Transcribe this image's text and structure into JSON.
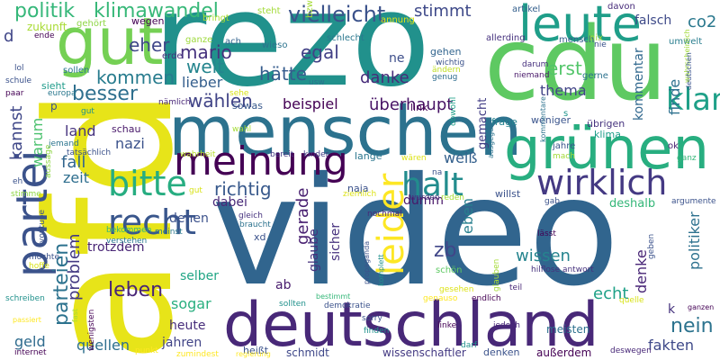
{
  "words": [
    {
      "text": "video",
      "color": "#31658e",
      "vertical": false
    },
    {
      "text": "afd",
      "color": "#e7e419",
      "vertical": true
    },
    {
      "text": "rezo",
      "color": "#21918c",
      "vertical": false
    },
    {
      "text": "cdu",
      "color": "#5ec962",
      "vertical": false
    },
    {
      "text": "menschen",
      "color": "#2c728e",
      "vertical": false
    },
    {
      "text": "deutschland",
      "color": "#482878",
      "vertical": false
    },
    {
      "text": "grünen",
      "color": "#28ae80",
      "vertical": false
    },
    {
      "text": "gut",
      "color": "#75d054",
      "vertical": false
    },
    {
      "text": "meinung",
      "color": "#440154",
      "vertical": false
    },
    {
      "text": "leute",
      "color": "#1f9e89",
      "vertical": false
    },
    {
      "text": "partei",
      "color": "#3b528b",
      "vertical": true
    },
    {
      "text": "wirklich",
      "color": "#443983",
      "vertical": false
    },
    {
      "text": "bitte",
      "color": "#27ad81",
      "vertical": false
    },
    {
      "text": "recht",
      "color": "#39568c",
      "vertical": false
    },
    {
      "text": "leider",
      "color": "#fde725",
      "vertical": true
    },
    {
      "text": "klar",
      "color": "#1fa088",
      "vertical": false
    },
    {
      "text": "vielleicht",
      "color": "#3b528b",
      "vertical": false
    },
    {
      "text": "halt",
      "color": "#228c8d",
      "vertical": false
    },
    {
      "text": "politik",
      "color": "#35b779",
      "vertical": false
    },
    {
      "text": "klimawandel",
      "color": "#37b878",
      "vertical": false
    },
    {
      "text": "stimmt",
      "color": "#3e4989",
      "vertical": false
    },
    {
      "text": "falsch",
      "color": "#3e4a89",
      "vertical": false
    },
    {
      "text": "co2",
      "color": "#2a788e",
      "vertical": false
    },
    {
      "text": "eher",
      "color": "#3f4788",
      "vertical": false
    },
    {
      "text": "mario",
      "color": "#46327e",
      "vertical": false
    },
    {
      "text": "egal",
      "color": "#424086",
      "vertical": false
    },
    {
      "text": "welt",
      "color": "#25858e",
      "vertical": false
    },
    {
      "text": "kommen",
      "color": "#287c8e",
      "vertical": false
    },
    {
      "text": "hätte",
      "color": "#365c8d",
      "vertical": false
    },
    {
      "text": "besser",
      "color": "#2e6f8e",
      "vertical": false
    },
    {
      "text": "lieber",
      "color": "#355f8d",
      "vertical": false
    },
    {
      "text": "danke",
      "color": "#472c7a",
      "vertical": false
    },
    {
      "text": "erst",
      "color": "#52c569",
      "vertical": false
    },
    {
      "text": "thema",
      "color": "#414487",
      "vertical": false
    },
    {
      "text": "finde",
      "color": "#2d708e",
      "vertical": true
    },
    {
      "text": "kommentar",
      "color": "#31688e",
      "vertical": true
    },
    {
      "text": "wählen",
      "color": "#414487",
      "vertical": false
    },
    {
      "text": "beispiel",
      "color": "#440154",
      "vertical": false
    },
    {
      "text": "überhaupt",
      "color": "#471365",
      "vertical": false
    },
    {
      "text": "kannst",
      "color": "#3f4788",
      "vertical": true
    },
    {
      "text": "warum",
      "color": "#4ac16d",
      "vertical": true
    },
    {
      "text": "nazi",
      "color": "#3b528b",
      "vertical": false
    },
    {
      "text": "land",
      "color": "#46337e",
      "vertical": false
    },
    {
      "text": "fall",
      "color": "#32658e",
      "vertical": false
    },
    {
      "text": "zeit",
      "color": "#2e6e8e",
      "vertical": false
    },
    {
      "text": "weiß",
      "color": "#34608d",
      "vertical": false
    },
    {
      "text": "richtig",
      "color": "#38598c",
      "vertical": false
    },
    {
      "text": "eben",
      "color": "#277f8e",
      "vertical": true
    },
    {
      "text": "parteien",
      "color": "#2c728e",
      "vertical": true
    },
    {
      "text": "problem",
      "color": "#443a83",
      "vertical": true
    },
    {
      "text": "trotzdem",
      "color": "#482475",
      "vertical": false
    },
    {
      "text": "leben",
      "color": "#482576",
      "vertical": false
    },
    {
      "text": "sogar",
      "color": "#29af7f",
      "vertical": false
    },
    {
      "text": "heute",
      "color": "#472d7b",
      "vertical": false
    },
    {
      "text": "jahren",
      "color": "#414487",
      "vertical": false
    },
    {
      "text": "geld",
      "color": "#2f6b8e",
      "vertical": false
    },
    {
      "text": "quellen",
      "color": "#2e6f8e",
      "vertical": false
    },
    {
      "text": "gerade",
      "color": "#481f70",
      "vertical": true
    },
    {
      "text": "sicher",
      "color": "#46307e",
      "vertical": true
    },
    {
      "text": "zb",
      "color": "#404688",
      "vertical": false
    },
    {
      "text": "wissen",
      "color": "#25848e",
      "vertical": false
    },
    {
      "text": "denke",
      "color": "#482576",
      "vertical": true
    },
    {
      "text": "echt",
      "color": "#1fa188",
      "vertical": false
    },
    {
      "text": "politiker",
      "color": "#2d718e",
      "vertical": true
    },
    {
      "text": "nein",
      "color": "#2c738e",
      "vertical": false
    },
    {
      "text": "fakten",
      "color": "#3e4989",
      "vertical": false
    },
    {
      "text": "denen",
      "color": "#3b518b",
      "vertical": false
    },
    {
      "text": "selber",
      "color": "#21a685",
      "vertical": false
    },
    {
      "text": "dabei",
      "color": "#482979",
      "vertical": false
    },
    {
      "text": "glaube",
      "color": "#46337e",
      "vertical": true
    },
    {
      "text": "schmidt",
      "color": "#3f4889",
      "vertical": false
    },
    {
      "text": "wissenschaftler",
      "color": "#443a83",
      "vertical": false
    },
    {
      "text": "dumm",
      "color": "#481769",
      "vertical": false
    },
    {
      "text": "außerdem",
      "color": "#440154",
      "vertical": false
    },
    {
      "text": "meisten",
      "color": "#2d718e",
      "vertical": false
    },
    {
      "text": "ne",
      "color": "#3d4e8a",
      "vertical": false
    },
    {
      "text": "ab",
      "color": "#481b6d",
      "vertical": false
    },
    {
      "text": "k",
      "color": "#46337e",
      "vertical": false
    },
    {
      "text": "d",
      "color": "#404688",
      "vertical": false
    },
    {
      "text": "zukunft",
      "color": "#a8db34",
      "vertical": false
    },
    {
      "text": "wegen",
      "color": "#440154",
      "vertical": false
    },
    {
      "text": "gehört",
      "color": "#8ed645",
      "vertical": false
    },
    {
      "text": "bringt",
      "color": "#aadc32",
      "vertical": false
    },
    {
      "text": "steht",
      "color": "#a2da37",
      "vertical": false
    },
    {
      "text": "annung",
      "color": "#dde318",
      "vertical": false
    },
    {
      "text": "artikel",
      "color": "#35608d",
      "vertical": false
    },
    {
      "text": "davon",
      "color": "#472c7a",
      "vertical": false
    },
    {
      "text": "umwelt",
      "color": "#287d8e",
      "vertical": false
    },
    {
      "text": "allerding",
      "color": "#46327e",
      "vertical": false
    },
    {
      "text": "mensch",
      "color": "#355e8d",
      "vertical": false
    },
    {
      "text": "nix",
      "color": "#9fda3a",
      "vertical": false
    },
    {
      "text": "schlecht",
      "color": "#2a778e",
      "vertical": false
    },
    {
      "text": "bzw",
      "color": "#a5db36",
      "vertical": true
    },
    {
      "text": "wieso",
      "color": "#2c738e",
      "vertical": false
    },
    {
      "text": "ganze",
      "color": "#9dd93b",
      "vertical": false
    },
    {
      "text": "ach",
      "color": "#33638d",
      "vertical": false
    },
    {
      "text": "erde",
      "color": "#46307e",
      "vertical": false
    },
    {
      "text": "sollen",
      "color": "#2a768e",
      "vertical": false
    },
    {
      "text": "sieht",
      "color": "#1e9b8a",
      "vertical": false
    },
    {
      "text": "europa",
      "color": "#2a788e",
      "vertical": false
    },
    {
      "text": "nämlich",
      "color": "#482677",
      "vertical": false
    },
    {
      "text": "sehe",
      "color": "#d8e219",
      "vertical": false
    },
    {
      "text": "sowas",
      "color": "#38598c",
      "vertical": false
    },
    {
      "text": "usw",
      "color": "#2c728e",
      "vertical": false
    },
    {
      "text": "link",
      "color": "#440154",
      "vertical": false
    },
    {
      "text": "gehen",
      "color": "#32658e",
      "vertical": false
    },
    {
      "text": "wichtig",
      "color": "#3b528b",
      "vertical": false
    },
    {
      "text": "genug",
      "color": "#2e6d8e",
      "vertical": false
    },
    {
      "text": "ändern",
      "color": "#c0df25",
      "vertical": false
    },
    {
      "text": "darum",
      "color": "#46307e",
      "vertical": false
    },
    {
      "text": "niemand",
      "color": "#481769",
      "vertical": false
    },
    {
      "text": "gerne",
      "color": "#2c728e",
      "vertical": false
    },
    {
      "text": "wahrscheinlich",
      "color": "#a0da39",
      "vertical": true
    },
    {
      "text": "deutschen",
      "color": "#3a548c",
      "vertical": true
    },
    {
      "text": "frage",
      "color": "#25838e",
      "vertical": false
    },
    {
      "text": "weniger",
      "color": "#3a548c",
      "vertical": false
    },
    {
      "text": "s",
      "color": "#1f958b",
      "vertical": false
    },
    {
      "text": "übrigen",
      "color": "#46337e",
      "vertical": false
    },
    {
      "text": "klima",
      "color": "#1f9e89",
      "vertical": false
    },
    {
      "text": "gemacht",
      "color": "#433e85",
      "vertical": true
    },
    {
      "text": "obwohl",
      "color": "#1f9f88",
      "vertical": true
    },
    {
      "text": "schau",
      "color": "#48186a",
      "vertical": false
    },
    {
      "text": "wahl",
      "color": "#a5db36",
      "vertical": false
    },
    {
      "text": "lange",
      "color": "#2a768e",
      "vertical": false
    },
    {
      "text": "kinder",
      "color": "#433e85",
      "vertical": false
    },
    {
      "text": "bereit",
      "color": "#443983",
      "vertical": false
    },
    {
      "text": "wahrheit",
      "color": "#b5de2b",
      "vertical": false
    },
    {
      "text": "tatsächlich",
      "color": "#3b528b",
      "vertical": false
    },
    {
      "text": "jemand",
      "color": "#2b748e",
      "vertical": false
    },
    {
      "text": "ok",
      "color": "#481f70",
      "vertical": false
    },
    {
      "text": "kommentare",
      "color": "#2c728e",
      "vertical": true
    },
    {
      "text": "jahre",
      "color": "#3a548c",
      "vertical": false
    },
    {
      "text": "mach",
      "color": "#a2da37",
      "vertical": false
    },
    {
      "text": "ganz",
      "color": "#35b779",
      "vertical": false
    },
    {
      "text": "ausgegen",
      "color": "#2c738e",
      "vertical": true
    },
    {
      "text": "stimme",
      "color": "#8ed645",
      "vertical": false
    },
    {
      "text": "aussage",
      "color": "#8ed645",
      "vertical": true
    },
    {
      "text": "bekommen",
      "color": "#34b679",
      "vertical": false
    },
    {
      "text": "verstehen",
      "color": "#2a788e",
      "vertical": false
    },
    {
      "text": "youtube",
      "color": "#3b528b",
      "vertical": true
    },
    {
      "text": "möchte",
      "color": "#3b528b",
      "vertical": false
    },
    {
      "text": "hoffe",
      "color": "#d8e219",
      "vertical": false
    },
    {
      "text": "meinst",
      "color": "#2a788e",
      "vertical": false
    },
    {
      "text": "gleich",
      "color": "#46327e",
      "vertical": false
    },
    {
      "text": "braucht",
      "color": "#2c728e",
      "vertical": false
    },
    {
      "text": "gut",
      "color": "#d8e219",
      "vertical": false
    },
    {
      "text": "naja",
      "color": "#3b528b",
      "vertical": false
    },
    {
      "text": "ziemlich",
      "color": "#dde318",
      "vertical": false
    },
    {
      "text": "reden",
      "color": "#a5db36",
      "vertical": false
    },
    {
      "text": "wurden",
      "color": "#46327e",
      "vertical": false
    },
    {
      "text": "willst",
      "color": "#3b528b",
      "vertical": false
    },
    {
      "text": "gab",
      "color": "#3b528b",
      "vertical": false
    },
    {
      "text": "deshalb",
      "color": "#35b779",
      "vertical": false
    },
    {
      "text": "argumente",
      "color": "#3b528b",
      "vertical": false
    },
    {
      "text": "xd",
      "color": "#3b528b",
      "vertical": false
    },
    {
      "text": "nochmal",
      "color": "#482878",
      "vertical": false
    },
    {
      "text": "propaganda",
      "color": "#3b528b",
      "vertical": true
    },
    {
      "text": "komplett",
      "color": "#21918c",
      "vertical": true
    },
    {
      "text": "schön",
      "color": "#5ec962",
      "vertical": false
    },
    {
      "text": "lässt",
      "color": "#440154",
      "vertical": false
    },
    {
      "text": "hilflose antwort",
      "color": "#46327e",
      "vertical": false
    },
    {
      "text": "geben",
      "color": "#3b528b",
      "vertical": true
    },
    {
      "text": "glauben",
      "color": "#a5db36",
      "vertical": true
    },
    {
      "text": "gesehen",
      "color": "#dde318",
      "vertical": false
    },
    {
      "text": "teil",
      "color": "#482878",
      "vertical": false
    },
    {
      "text": "quelle",
      "color": "#d8e219",
      "vertical": false
    },
    {
      "text": "ganzen",
      "color": "#440154",
      "vertical": false
    },
    {
      "text": "bestimmt",
      "color": "#35b779",
      "vertical": false
    },
    {
      "text": "demokratie",
      "color": "#3b528b",
      "vertical": false
    },
    {
      "text": "genauso",
      "color": "#fde725",
      "vertical": false
    },
    {
      "text": "endlich",
      "color": "#440154",
      "vertical": false
    },
    {
      "text": "sollten",
      "color": "#21918c",
      "vertical": false
    },
    {
      "text": "sorry",
      "color": "#3b528b",
      "vertical": false
    },
    {
      "text": "finden",
      "color": "#21918c",
      "vertical": false
    },
    {
      "text": "jedoch",
      "color": "#482878",
      "vertical": false
    },
    {
      "text": "darf",
      "color": "#21918c",
      "vertical": false
    },
    {
      "text": "linke",
      "color": "#440154",
      "vertical": false
    },
    {
      "text": "denken",
      "color": "#3b528b",
      "vertical": false
    },
    {
      "text": "deswegen",
      "color": "#482878",
      "vertical": false
    },
    {
      "text": "heißt",
      "color": "#3b528b",
      "vertical": false
    },
    {
      "text": "punkt",
      "color": "#fde725",
      "vertical": false
    },
    {
      "text": "zumindest",
      "color": "#fde725",
      "vertical": false
    },
    {
      "text": "regierung",
      "color": "#fde725",
      "vertical": false
    },
    {
      "text": "internet",
      "color": "#440154",
      "vertical": false
    },
    {
      "text": "schreiben",
      "color": "#21918c",
      "vertical": false
    },
    {
      "text": "passiert",
      "color": "#fde725",
      "vertical": false
    },
    {
      "text": "wenigsten",
      "color": "#440154",
      "vertical": true
    },
    {
      "text": "fast",
      "color": "#a5db36",
      "vertical": true
    },
    {
      "text": "lol",
      "color": "#3b528b",
      "vertical": false
    },
    {
      "text": "schule",
      "color": "#3b528b",
      "vertical": false
    },
    {
      "text": "ende",
      "color": "#440154",
      "vertical": false
    },
    {
      "text": "paar",
      "color": "#440154",
      "vertical": false
    },
    {
      "text": "p",
      "color": "#3b528b",
      "vertical": false
    },
    {
      "text": "eh",
      "color": "#3b528b",
      "vertical": false
    },
    {
      "text": "gut",
      "color": "#21918c",
      "vertical": false
    },
    {
      "text": "wären",
      "color": "#dde318",
      "vertical": false
    },
    {
      "text": "na",
      "color": "#3b528b",
      "vertical": false
    },
    {
      "text": "nie",
      "color": "#3b528b",
      "vertical": false
    }
  ]
}
